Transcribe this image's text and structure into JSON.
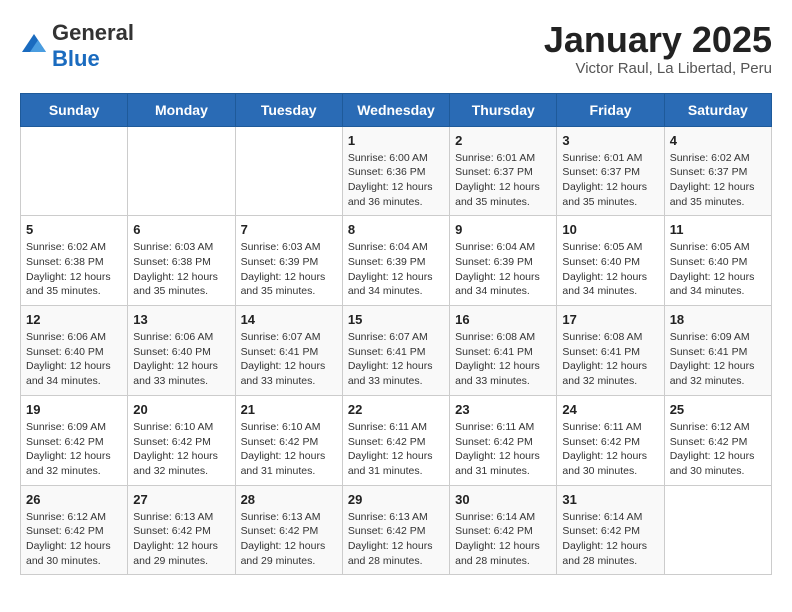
{
  "logo": {
    "general": "General",
    "blue": "Blue"
  },
  "calendar": {
    "title": "January 2025",
    "subtitle": "Victor Raul, La Libertad, Peru"
  },
  "headers": [
    "Sunday",
    "Monday",
    "Tuesday",
    "Wednesday",
    "Thursday",
    "Friday",
    "Saturday"
  ],
  "weeks": [
    [
      {
        "day": "",
        "info": ""
      },
      {
        "day": "",
        "info": ""
      },
      {
        "day": "",
        "info": ""
      },
      {
        "day": "1",
        "info": "Sunrise: 6:00 AM\nSunset: 6:36 PM\nDaylight: 12 hours and 36 minutes."
      },
      {
        "day": "2",
        "info": "Sunrise: 6:01 AM\nSunset: 6:37 PM\nDaylight: 12 hours and 35 minutes."
      },
      {
        "day": "3",
        "info": "Sunrise: 6:01 AM\nSunset: 6:37 PM\nDaylight: 12 hours and 35 minutes."
      },
      {
        "day": "4",
        "info": "Sunrise: 6:02 AM\nSunset: 6:37 PM\nDaylight: 12 hours and 35 minutes."
      }
    ],
    [
      {
        "day": "5",
        "info": "Sunrise: 6:02 AM\nSunset: 6:38 PM\nDaylight: 12 hours and 35 minutes."
      },
      {
        "day": "6",
        "info": "Sunrise: 6:03 AM\nSunset: 6:38 PM\nDaylight: 12 hours and 35 minutes."
      },
      {
        "day": "7",
        "info": "Sunrise: 6:03 AM\nSunset: 6:39 PM\nDaylight: 12 hours and 35 minutes."
      },
      {
        "day": "8",
        "info": "Sunrise: 6:04 AM\nSunset: 6:39 PM\nDaylight: 12 hours and 34 minutes."
      },
      {
        "day": "9",
        "info": "Sunrise: 6:04 AM\nSunset: 6:39 PM\nDaylight: 12 hours and 34 minutes."
      },
      {
        "day": "10",
        "info": "Sunrise: 6:05 AM\nSunset: 6:40 PM\nDaylight: 12 hours and 34 minutes."
      },
      {
        "day": "11",
        "info": "Sunrise: 6:05 AM\nSunset: 6:40 PM\nDaylight: 12 hours and 34 minutes."
      }
    ],
    [
      {
        "day": "12",
        "info": "Sunrise: 6:06 AM\nSunset: 6:40 PM\nDaylight: 12 hours and 34 minutes."
      },
      {
        "day": "13",
        "info": "Sunrise: 6:06 AM\nSunset: 6:40 PM\nDaylight: 12 hours and 33 minutes."
      },
      {
        "day": "14",
        "info": "Sunrise: 6:07 AM\nSunset: 6:41 PM\nDaylight: 12 hours and 33 minutes."
      },
      {
        "day": "15",
        "info": "Sunrise: 6:07 AM\nSunset: 6:41 PM\nDaylight: 12 hours and 33 minutes."
      },
      {
        "day": "16",
        "info": "Sunrise: 6:08 AM\nSunset: 6:41 PM\nDaylight: 12 hours and 33 minutes."
      },
      {
        "day": "17",
        "info": "Sunrise: 6:08 AM\nSunset: 6:41 PM\nDaylight: 12 hours and 32 minutes."
      },
      {
        "day": "18",
        "info": "Sunrise: 6:09 AM\nSunset: 6:41 PM\nDaylight: 12 hours and 32 minutes."
      }
    ],
    [
      {
        "day": "19",
        "info": "Sunrise: 6:09 AM\nSunset: 6:42 PM\nDaylight: 12 hours and 32 minutes."
      },
      {
        "day": "20",
        "info": "Sunrise: 6:10 AM\nSunset: 6:42 PM\nDaylight: 12 hours and 32 minutes."
      },
      {
        "day": "21",
        "info": "Sunrise: 6:10 AM\nSunset: 6:42 PM\nDaylight: 12 hours and 31 minutes."
      },
      {
        "day": "22",
        "info": "Sunrise: 6:11 AM\nSunset: 6:42 PM\nDaylight: 12 hours and 31 minutes."
      },
      {
        "day": "23",
        "info": "Sunrise: 6:11 AM\nSunset: 6:42 PM\nDaylight: 12 hours and 31 minutes."
      },
      {
        "day": "24",
        "info": "Sunrise: 6:11 AM\nSunset: 6:42 PM\nDaylight: 12 hours and 30 minutes."
      },
      {
        "day": "25",
        "info": "Sunrise: 6:12 AM\nSunset: 6:42 PM\nDaylight: 12 hours and 30 minutes."
      }
    ],
    [
      {
        "day": "26",
        "info": "Sunrise: 6:12 AM\nSunset: 6:42 PM\nDaylight: 12 hours and 30 minutes."
      },
      {
        "day": "27",
        "info": "Sunrise: 6:13 AM\nSunset: 6:42 PM\nDaylight: 12 hours and 29 minutes."
      },
      {
        "day": "28",
        "info": "Sunrise: 6:13 AM\nSunset: 6:42 PM\nDaylight: 12 hours and 29 minutes."
      },
      {
        "day": "29",
        "info": "Sunrise: 6:13 AM\nSunset: 6:42 PM\nDaylight: 12 hours and 28 minutes."
      },
      {
        "day": "30",
        "info": "Sunrise: 6:14 AM\nSunset: 6:42 PM\nDaylight: 12 hours and 28 minutes."
      },
      {
        "day": "31",
        "info": "Sunrise: 6:14 AM\nSunset: 6:42 PM\nDaylight: 12 hours and 28 minutes."
      },
      {
        "day": "",
        "info": ""
      }
    ]
  ]
}
